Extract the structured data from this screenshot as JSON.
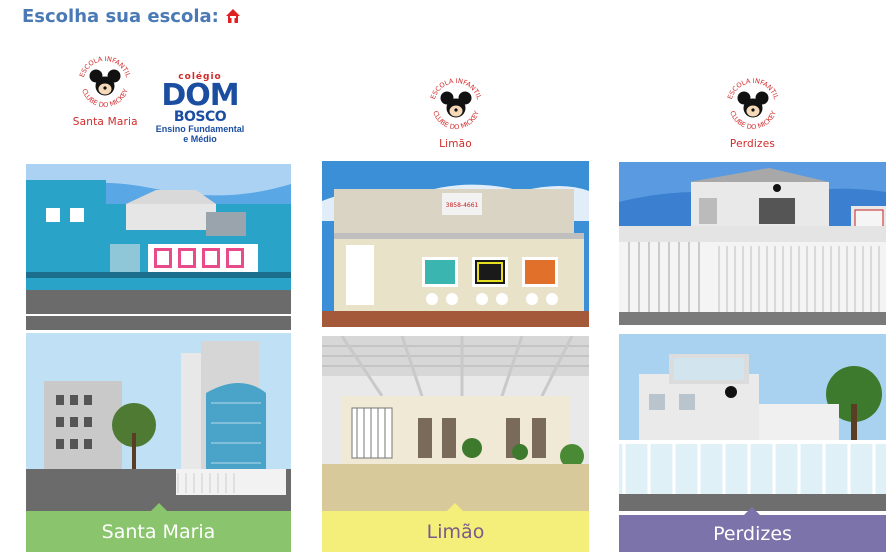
{
  "header": {
    "title": "Escolha sua escola:",
    "icon": "home-icon",
    "icon_color": "#e02020",
    "title_color": "#4a7ab5"
  },
  "seal_text": {
    "top": "ESCOLA INFANTIL",
    "bottom": "CLUBE DO MICKEY"
  },
  "dom_bosco_logo": {
    "small": "colégio",
    "big": "DOM",
    "big2": "BOSCO",
    "line1": "Ensino Fundamental",
    "line2": "e Médio"
  },
  "schools": [
    {
      "id": "santa-maria",
      "caption": "Santa Maria",
      "label": "Santa Maria",
      "label_bg": "#8ac56e",
      "label_color": "#ffffff"
    },
    {
      "id": "limao",
      "caption": "Limão",
      "label": "Limão",
      "label_bg": "#f4ee7a",
      "label_color": "#7a5a8a",
      "sign_phone": "3858-4661"
    },
    {
      "id": "perdizes",
      "caption": "Perdizes",
      "label": "Perdizes",
      "label_bg": "#7b73aa",
      "label_color": "#ffffff"
    }
  ]
}
